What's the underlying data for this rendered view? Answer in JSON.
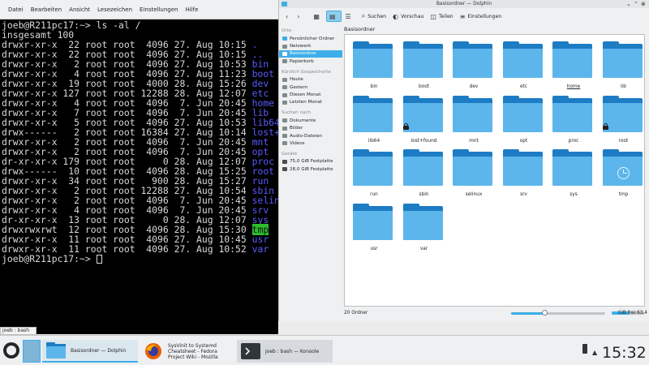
{
  "konsole": {
    "menu": [
      "Datei",
      "Bearbeiten",
      "Ansicht",
      "Lesezeichen",
      "Einstellungen",
      "Hilfe"
    ],
    "lines": [
      {
        "prefix": "joeb@R211pc17:~> ls -al /",
        "name": ""
      },
      {
        "prefix": "insgesamt 100",
        "name": ""
      },
      {
        "prefix": "drwxr-xr-x  22 root root  4096 27. Aug 10:15 ",
        "name": "."
      },
      {
        "prefix": "drwxr-xr-x  22 root root  4096 27. Aug 10:15 ",
        "name": ".."
      },
      {
        "prefix": "drwxr-xr-x   2 root root  4096 27. Aug 10:53 ",
        "name": "bin"
      },
      {
        "prefix": "drwxr-xr-x   4 root root  4096 27. Aug 11:23 ",
        "name": "boot"
      },
      {
        "prefix": "drwxr-xr-x  19 root root  4000 28. Aug 15:26 ",
        "name": "dev"
      },
      {
        "prefix": "drwxr-xr-x 127 root root 12288 28. Aug 12:07 ",
        "name": "etc"
      },
      {
        "prefix": "drwxr-xr-x   4 root root  4096  7. Jun 20:45 ",
        "name": "home"
      },
      {
        "prefix": "drwxr-xr-x   7 root root  4096  7. Jun 20:45 ",
        "name": "lib"
      },
      {
        "prefix": "drwxr-xr-x   5 root root  4096 27. Aug 10:53 ",
        "name": "lib64"
      },
      {
        "prefix": "drwx------   2 root root 16384 27. Aug 10:14 ",
        "name": "lost+found"
      },
      {
        "prefix": "drwxr-xr-x   2 root root  4096  7. Jun 20:45 ",
        "name": "mnt"
      },
      {
        "prefix": "drwxr-xr-x   2 root root  4096  7. Jun 20:45 ",
        "name": "opt"
      },
      {
        "prefix": "dr-xr-xr-x 179 root root     0 28. Aug 12:07 ",
        "name": "proc"
      },
      {
        "prefix": "drwx------  10 root root  4096 28. Aug 15:25 ",
        "name": "root"
      },
      {
        "prefix": "drwxr-xr-x  34 root root   900 28. Aug 15:27 ",
        "name": "run"
      },
      {
        "prefix": "drwxr-xr-x   2 root root 12288 27. Aug 10:54 ",
        "name": "sbin"
      },
      {
        "prefix": "drwxr-xr-x   2 root root  4096  7. Jun 20:45 ",
        "name": "selinux"
      },
      {
        "prefix": "drwxr-xr-x   4 root root  4096  7. Jun 20:45 ",
        "name": "srv"
      },
      {
        "prefix": "dr-xr-xr-x  13 root root     0 28. Aug 12:07 ",
        "name": "sys"
      },
      {
        "prefix": "drwxrwxrwt  12 root root  4096 28. Aug 15:30 ",
        "name": "tmp",
        "highlight": true
      },
      {
        "prefix": "drwxr-xr-x  11 root root  4096 27. Aug 10:45 ",
        "name": "usr"
      },
      {
        "prefix": "drwxr-xr-x  11 root root  4096 27. Aug 10:52 ",
        "name": "var"
      },
      {
        "prefix": "joeb@R211pc17:~> ",
        "name": "",
        "cursor": true
      }
    ]
  },
  "dolphin": {
    "title": "Basisordner — Dolphin",
    "toolbar": {
      "search": "Suchen",
      "preview": "Vorschau",
      "split": "Teilen",
      "settings": "Einstellungen"
    },
    "sidebar": {
      "places_header": "Orte",
      "places": [
        {
          "label": "Persönlicher Ordner",
          "icon": "home-icon"
        },
        {
          "label": "Netzwerk",
          "icon": "network-icon"
        },
        {
          "label": "Basisordner",
          "icon": "root-folder-icon",
          "selected": true
        },
        {
          "label": "Papierkorb",
          "icon": "trash-icon"
        }
      ],
      "recent_header": "Kürzlich Gespeicherte",
      "recent": [
        {
          "label": "Heute",
          "icon": "calendar-icon"
        },
        {
          "label": "Gestern",
          "icon": "calendar-icon"
        },
        {
          "label": "Diesen Monat",
          "icon": "calendar-icon"
        },
        {
          "label": "Letzten Monat",
          "icon": "calendar-icon"
        }
      ],
      "search_header": "Suchen nach",
      "search": [
        {
          "label": "Dokumente",
          "icon": "document-icon"
        },
        {
          "label": "Bilder",
          "icon": "image-icon"
        },
        {
          "label": "Audio-Dateien",
          "icon": "audio-icon"
        },
        {
          "label": "Videos",
          "icon": "video-icon"
        }
      ],
      "devices_header": "Geräte",
      "devices": [
        {
          "label": "75,0 GiB Festplatte",
          "icon": "harddisk-icon"
        },
        {
          "label": "28,0 GiB Festplatte",
          "icon": "harddisk-icon"
        }
      ]
    },
    "breadcrumb": "Basisordner",
    "folders": [
      {
        "name": "bin"
      },
      {
        "name": "boot"
      },
      {
        "name": "dev"
      },
      {
        "name": "etc"
      },
      {
        "name": "home",
        "underline": true
      },
      {
        "name": "lib"
      },
      {
        "name": "lib64"
      },
      {
        "name": "lost+found",
        "locked": true
      },
      {
        "name": "mnt"
      },
      {
        "name": "opt"
      },
      {
        "name": "proc"
      },
      {
        "name": "root",
        "locked": true
      },
      {
        "name": "run"
      },
      {
        "name": "sbin"
      },
      {
        "name": "selinux"
      },
      {
        "name": "srv"
      },
      {
        "name": "sys"
      },
      {
        "name": "tmp",
        "clock": true
      },
      {
        "name": "usr"
      },
      {
        "name": "var"
      }
    ],
    "status": {
      "count": "20 Ordner",
      "free": "63,4 GiB frei",
      "zoom_level": 0.35,
      "space_used": 0.55
    }
  },
  "taskbar": {
    "tooltip": "joeb : bash",
    "tasks": [
      {
        "label": "Basisordner — Dolphin",
        "icon": "folder-icon"
      },
      {
        "label": "SysVinit to Systemd Cheatsheet - Fedora Project Wiki - Mozilla Firefox",
        "icon": "firefox-icon"
      },
      {
        "label": "joeb : bash — Konsole",
        "icon": "terminal-icon"
      }
    ],
    "clock": "15:32"
  },
  "colors": {
    "accent": "#3daee9",
    "folder_front": "#5cb6ec",
    "folder_back": "#1d7cc4",
    "terminal_dir": "#5a5aff",
    "terminal_highlight": "#2ebd2e"
  }
}
